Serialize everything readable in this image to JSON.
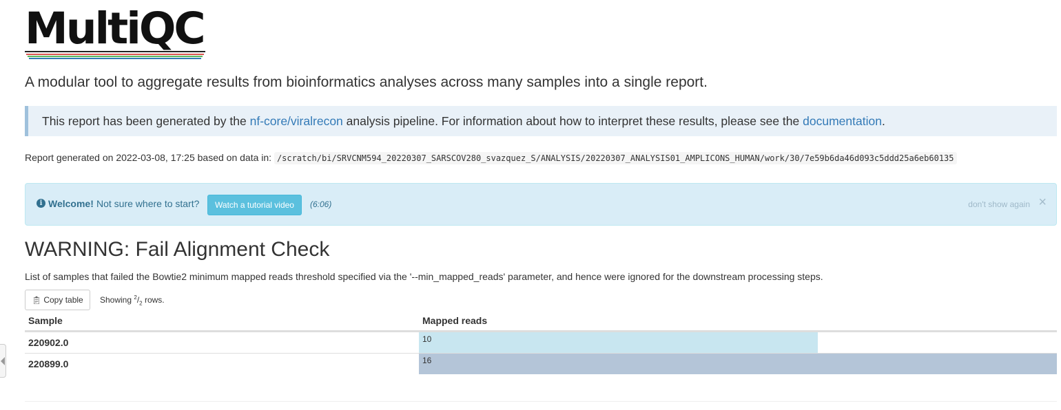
{
  "logo": {
    "text": "MultiQC"
  },
  "lead": "A modular tool to aggregate results from bioinformatics analyses across many samples into a single report.",
  "intro": {
    "before": "This report has been generated by the ",
    "link1": "nf-core/viralrecon",
    "middle": " analysis pipeline. For information about how to interpret these results, please see the ",
    "link2": "documentation",
    "after": "."
  },
  "report_meta": {
    "prefix": "Report generated on 2022-03-08, 17:25 based on data in:",
    "path": "/scratch/bi/SRVCNM594_20220307_SARSCOV280_svazquez_S/ANALYSIS/20220307_ANALYSIS01_AMPLICONS_HUMAN/work/30/7e59b6da46d093c5ddd25a6eb60135"
  },
  "welcome": {
    "icon": "info-circle-icon",
    "strong": "Welcome!",
    "text": "Not sure where to start?",
    "button": "Watch a tutorial video",
    "duration": "(6:06)",
    "dont_show": "don't show again",
    "close": "×"
  },
  "section": {
    "title": "WARNING: Fail Alignment Check",
    "description": "List of samples that failed the Bowtie2 minimum mapped reads threshold specified via the '--min_mapped_reads' parameter, and hence were ignored for the downstream processing steps."
  },
  "table_controls": {
    "copy_label": "Copy table",
    "showing_prefix": "Showing",
    "showing_num": "2",
    "showing_den": "2",
    "showing_suffix": "rows."
  },
  "table": {
    "columns": [
      "Sample",
      "Mapped reads"
    ],
    "max_value": 16,
    "rows": [
      {
        "sample": "220902.0",
        "mapped_reads": "10",
        "value": 10,
        "bar_color": "#c8e6f0"
      },
      {
        "sample": "220899.0",
        "mapped_reads": "16",
        "value": 16,
        "bar_color": "#b4c5d8"
      }
    ]
  },
  "colors": {
    "link": "#337ab7",
    "info_bg": "#d9edf7",
    "info_text": "#31708f",
    "button_info": "#5bc0de"
  }
}
